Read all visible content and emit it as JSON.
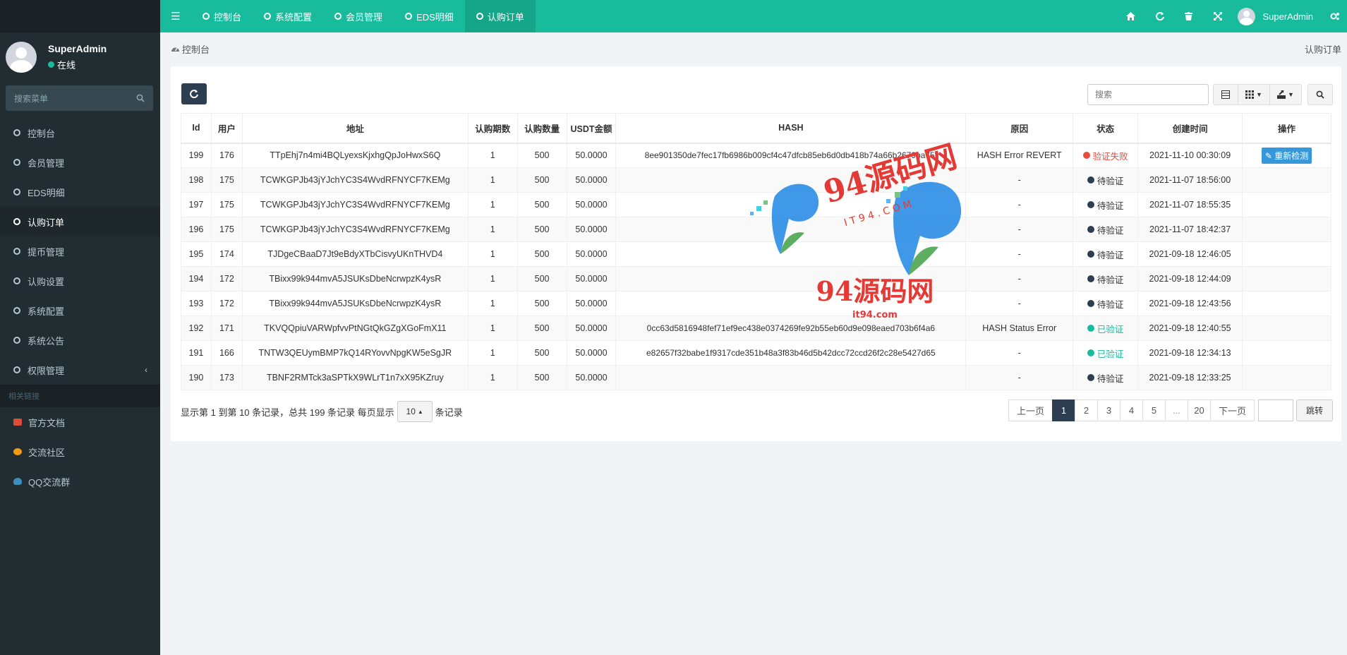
{
  "sidebar": {
    "user_name": "SuperAdmin",
    "user_status": "在线",
    "search_placeholder": "搜索菜单",
    "menu": [
      {
        "label": "控制台"
      },
      {
        "label": "会员管理"
      },
      {
        "label": "EDS明细"
      },
      {
        "label": "认购订单"
      },
      {
        "label": "提币管理"
      },
      {
        "label": "认购设置"
      },
      {
        "label": "系统配置"
      },
      {
        "label": "系统公告"
      },
      {
        "label": "权限管理"
      }
    ],
    "section_header": "相关链接",
    "links": [
      {
        "label": "官方文档",
        "color": "#dd4b39"
      },
      {
        "label": "交流社区",
        "color": "#f39c12"
      },
      {
        "label": "QQ交流群",
        "color": "#3c8dbc"
      }
    ]
  },
  "topnav": {
    "tabs": [
      {
        "label": "控制台"
      },
      {
        "label": "系统配置"
      },
      {
        "label": "会员管理"
      },
      {
        "label": "EDS明细"
      },
      {
        "label": "认购订单"
      }
    ],
    "user_name": "SuperAdmin",
    "accent": "#18bc9c"
  },
  "breadcrumb": {
    "home": "控制台",
    "current": "认购订单"
  },
  "toolbar": {
    "search_placeholder": "搜索"
  },
  "table": {
    "headers": [
      "Id",
      "用户",
      "地址",
      "认购期数",
      "认购数量",
      "USDT金额",
      "HASH",
      "原因",
      "状态",
      "创建时间",
      "操作"
    ],
    "rows": [
      {
        "id": "199",
        "user": "176",
        "addr": "TTpEhj7n4mi4BQLyexsKjxhgQpJoHwxS6Q",
        "period": "1",
        "qty": "500",
        "usdt": "50.0000",
        "hash": "8ee901350de7fec17fb6986b009cf4c47dfcb85eb6d0db418b74a66b2679ba75f",
        "reason": "HASH Error REVERT",
        "status": "验证失败",
        "status_color": "#e74c3c",
        "created": "2021-11-10 00:30:09",
        "action": "重新检测"
      },
      {
        "id": "198",
        "user": "175",
        "addr": "TCWKGPJb43jYJchYC3S4WvdRFNYCF7KEMg",
        "period": "1",
        "qty": "500",
        "usdt": "50.0000",
        "hash": "",
        "reason": "-",
        "status": "待验证",
        "status_color": "#2c3e50",
        "created": "2021-11-07 18:56:00",
        "action": ""
      },
      {
        "id": "197",
        "user": "175",
        "addr": "TCWKGPJb43jYJchYC3S4WvdRFNYCF7KEMg",
        "period": "1",
        "qty": "500",
        "usdt": "50.0000",
        "hash": "",
        "reason": "-",
        "status": "待验证",
        "status_color": "#2c3e50",
        "created": "2021-11-07 18:55:35",
        "action": ""
      },
      {
        "id": "196",
        "user": "175",
        "addr": "TCWKGPJb43jYJchYC3S4WvdRFNYCF7KEMg",
        "period": "1",
        "qty": "500",
        "usdt": "50.0000",
        "hash": "",
        "reason": "-",
        "status": "待验证",
        "status_color": "#2c3e50",
        "created": "2021-11-07 18:42:37",
        "action": ""
      },
      {
        "id": "195",
        "user": "174",
        "addr": "TJDgeCBaaD7Jt9eBdyXTbCisvyUKnTHVD4",
        "period": "1",
        "qty": "500",
        "usdt": "50.0000",
        "hash": "",
        "reason": "-",
        "status": "待验证",
        "status_color": "#2c3e50",
        "created": "2021-09-18 12:46:05",
        "action": ""
      },
      {
        "id": "194",
        "user": "172",
        "addr": "TBixx99k944mvA5JSUKsDbeNcrwpzK4ysR",
        "period": "1",
        "qty": "500",
        "usdt": "50.0000",
        "hash": "",
        "reason": "-",
        "status": "待验证",
        "status_color": "#2c3e50",
        "created": "2021-09-18 12:44:09",
        "action": ""
      },
      {
        "id": "193",
        "user": "172",
        "addr": "TBixx99k944mvA5JSUKsDbeNcrwpzK4ysR",
        "period": "1",
        "qty": "500",
        "usdt": "50.0000",
        "hash": "",
        "reason": "-",
        "status": "待验证",
        "status_color": "#2c3e50",
        "created": "2021-09-18 12:43:56",
        "action": ""
      },
      {
        "id": "192",
        "user": "171",
        "addr": "TKVQQpiuVARWpfvvPtNGtQkGZgXGoFmX11",
        "period": "1",
        "qty": "500",
        "usdt": "50.0000",
        "hash": "0cc63d5816948fef71ef9ec438e0374269fe92b55eb60d9e098eaed703b6f4a6",
        "reason": "HASH Status Error",
        "status": "已验证",
        "status_color": "#18bc9c",
        "created": "2021-09-18 12:40:55",
        "action": ""
      },
      {
        "id": "191",
        "user": "166",
        "addr": "TNTW3QEUymBMP7kQ14RYovvNpgKW5eSgJR",
        "period": "1",
        "qty": "500",
        "usdt": "50.0000",
        "hash": "e82657f32babe1f9317cde351b48a3f83b46d5b42dcc72ccd26f2c28e5427d65",
        "reason": "-",
        "status": "已验证",
        "status_color": "#18bc9c",
        "created": "2021-09-18 12:34:13",
        "action": ""
      },
      {
        "id": "190",
        "user": "173",
        "addr": "TBNF2RMTck3aSPTkX9WLrT1n7xX95KZruy",
        "period": "1",
        "qty": "500",
        "usdt": "50.0000",
        "hash": "",
        "reason": "-",
        "status": "待验证",
        "status_color": "#2c3e50",
        "created": "2021-09-18 12:33:25",
        "action": ""
      }
    ]
  },
  "footer": {
    "summary": "显示第 1 到第 10 条记录，总共 199 条记录 每页显示",
    "page_size": "10",
    "suffix": "条记录",
    "pages": [
      "上一页",
      "1",
      "2",
      "3",
      "4",
      "5",
      "...",
      "20",
      "下一页"
    ],
    "active_page": "1",
    "jump": "跳转"
  },
  "watermark": {
    "text_top": "94源码网",
    "text_bottom": "94源码网",
    "sub_top": "I T 9 4 . C O M",
    "sub_bottom": "it94.com"
  }
}
